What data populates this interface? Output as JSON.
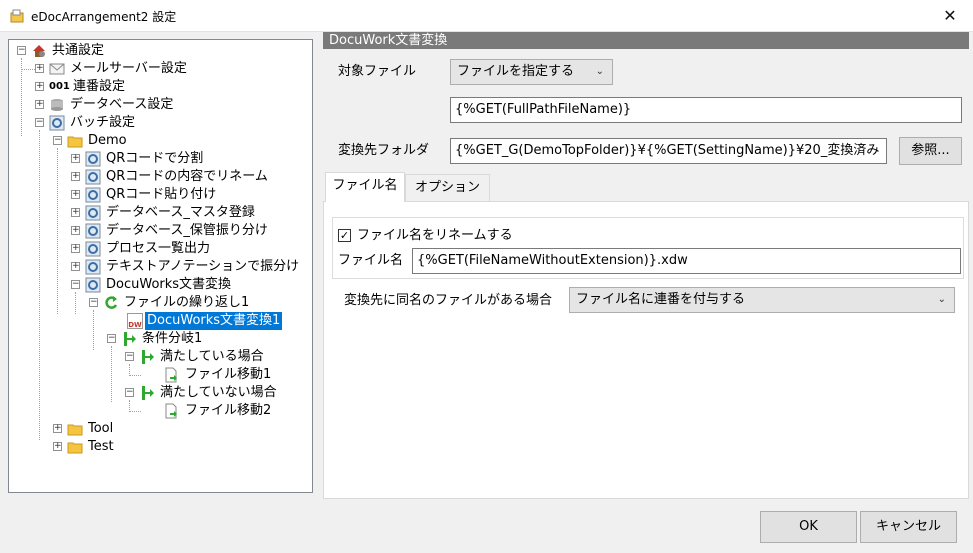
{
  "window": {
    "title": "eDocArrangement2 設定",
    "close_glyph": "✕",
    "icon": "folder-app-icon"
  },
  "tree": {
    "nodes": [
      {
        "label": "共通設定",
        "icon": "house-settings-icon",
        "expander": "−"
      },
      {
        "label": "メールサーバー設定",
        "icon": "envelope-icon",
        "expander": "+"
      },
      {
        "label": "連番設定",
        "icon": "number-001-icon",
        "icon_text": "001",
        "expander": "+"
      },
      {
        "label": "データベース設定",
        "icon": "database-icon",
        "expander": "+"
      },
      {
        "label": "バッチ設定",
        "icon": "batch-gear-icon",
        "expander": "−"
      },
      {
        "label": "Demo",
        "icon": "folder-icon",
        "expander": "−"
      },
      {
        "label": "QRコードで分割",
        "icon": "batch-gear-icon",
        "expander": "+"
      },
      {
        "label": "QRコードの内容でリネーム",
        "icon": "batch-gear-icon",
        "expander": "+"
      },
      {
        "label": "QRコード貼り付け",
        "icon": "batch-gear-icon",
        "expander": "+"
      },
      {
        "label": "データベース_マスタ登録",
        "icon": "batch-gear-icon",
        "expander": "+"
      },
      {
        "label": "データベース_保管振り分け",
        "icon": "batch-gear-icon",
        "expander": "+"
      },
      {
        "label": "プロセス一覧出力",
        "icon": "batch-gear-icon",
        "expander": "+"
      },
      {
        "label": "テキストアノテーションで振分け",
        "icon": "batch-gear-icon",
        "expander": "+"
      },
      {
        "label": "DocuWorks文書変換",
        "icon": "batch-gear-icon",
        "expander": "−"
      },
      {
        "label": "ファイルの繰り返し1",
        "icon": "loop-arrow-icon",
        "expander": "−"
      },
      {
        "label": "DocuWorks文書変換1",
        "icon": "docuworks-file-icon",
        "icon_text": "DW",
        "selected": true
      },
      {
        "label": "条件分岐1",
        "icon": "branch-icon",
        "expander": "−"
      },
      {
        "label": "満たしている場合",
        "icon": "branch-icon",
        "expander": "−"
      },
      {
        "label": "ファイル移動1",
        "icon": "file-move-icon"
      },
      {
        "label": "満たしていない場合",
        "icon": "branch-icon",
        "expander": "−"
      },
      {
        "label": "ファイル移動2",
        "icon": "file-move-icon"
      },
      {
        "label": "Tool",
        "icon": "folder-icon",
        "expander": "+"
      },
      {
        "label": "Test",
        "icon": "folder-icon",
        "expander": "+"
      }
    ]
  },
  "panel": {
    "header": "DocuWork文書変換",
    "target_file_label": "対象ファイル",
    "target_file_mode": "ファイルを指定する",
    "target_file_path": "{%GET(FullPathFileName)}",
    "dest_folder_label": "変換先フォルダ",
    "dest_folder_value": "{%GET_G(DemoTopFolder)}¥{%GET(SettingName)}¥20_変換済み",
    "browse_button": "参照...",
    "tabs": [
      "ファイル名",
      "オプション"
    ],
    "rename_checkbox_label": "ファイル名をリネームする",
    "rename_checked": true,
    "filename_label": "ファイル名",
    "filename_value": "{%GET(FileNameWithoutExtension)}.xdw",
    "duplicate_label": "変換先に同名のファイルがある場合",
    "duplicate_option": "ファイル名に連番を付与する"
  },
  "footer": {
    "ok_button": "OK",
    "cancel_button": "キャンセル"
  },
  "colors": {
    "selection": "#0078d7",
    "header_bg": "#7a7a7a",
    "folder": "#f5c542",
    "branch_green": "#2fa82f"
  }
}
